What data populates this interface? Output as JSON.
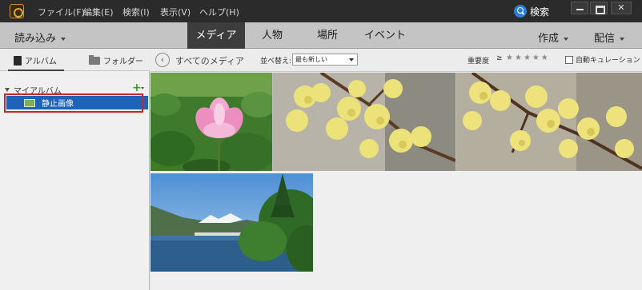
{
  "menubar": {
    "items": [
      "ファイル(F)",
      "編集(E)",
      "検索(I)",
      "表示(V)",
      "ヘルプ(H)"
    ],
    "search_label": "検索"
  },
  "navbar": {
    "import_label": "読み込み",
    "tabs": [
      "メディア",
      "人物",
      "場所",
      "イベント"
    ],
    "active_tab": "メディア",
    "create_label": "作成",
    "share_label": "配信"
  },
  "leftpanel": {
    "tab_album": "アルバム",
    "tab_folder": "フォルダー",
    "my_albums": "マイアルバム",
    "albums": [
      {
        "label": "静止画像",
        "selected": true
      }
    ]
  },
  "subbar": {
    "all_media": "すべてのメディア",
    "sort_label": "並べ替え:",
    "sort_value": "最も新しい",
    "rating_label": "重要度",
    "rating_op": "≥",
    "rating_stars": 0,
    "auto_curation": "自動キュレーション",
    "auto_curation_checked": false
  },
  "colors": {
    "menubar_bg": "#2b2b2b",
    "navbar_bg": "#c4c4c4",
    "active_tab_bg": "#3d3d3d",
    "selection_blue": "#1e63b8",
    "highlight_red": "#d6202a"
  },
  "photos": [
    {
      "subject": "lotus-flower"
    },
    {
      "subject": "yellow-blossoms"
    },
    {
      "subject": "yellow-blossoms"
    },
    {
      "subject": "lake-landscape"
    }
  ]
}
